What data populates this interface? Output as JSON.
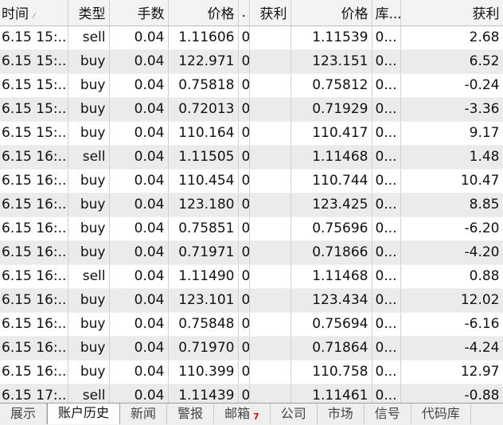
{
  "columns": [
    "时间",
    "类型",
    "手数",
    "价格",
    ".",
    "获利",
    "价格",
    "库...",
    "获利"
  ],
  "rows": [
    [
      "6.15 15:...",
      "sell",
      "0.04",
      "1.11606",
      "0.0...",
      "1.11539",
      "0...",
      "2.68"
    ],
    [
      "6.15 15:...",
      "buy",
      "0.04",
      "122.971",
      "0....",
      "123.151",
      "0...",
      "6.52"
    ],
    [
      "6.15 15:...",
      "buy",
      "0.04",
      "0.75818",
      "0.0...",
      "0.75812",
      "0...",
      "-0.24"
    ],
    [
      "6.15 15:...",
      "buy",
      "0.04",
      "0.72013",
      "0.0...",
      "0.71929",
      "0...",
      "-3.36"
    ],
    [
      "6.15 15:...",
      "buy",
      "0.04",
      "110.164",
      "0....",
      "110.417",
      "0...",
      "9.17"
    ],
    [
      "6.15 16:...",
      "sell",
      "0.04",
      "1.11505",
      "0.0...",
      "1.11468",
      "0...",
      "1.48"
    ],
    [
      "6.15 16:...",
      "buy",
      "0.04",
      "110.454",
      "0....",
      "110.744",
      "0...",
      "10.47"
    ],
    [
      "6.15 16:...",
      "buy",
      "0.04",
      "123.180",
      "0....",
      "123.425",
      "0...",
      "8.85"
    ],
    [
      "6.15 16:...",
      "buy",
      "0.04",
      "0.75851",
      "0.0...",
      "0.75696",
      "0...",
      "-6.20"
    ],
    [
      "6.15 16:...",
      "buy",
      "0.04",
      "0.71971",
      "0.0...",
      "0.71866",
      "0...",
      "-4.20"
    ],
    [
      "6.15 16:...",
      "sell",
      "0.04",
      "1.11490",
      "0.0...",
      "1.11468",
      "0...",
      "0.88"
    ],
    [
      "6.15 16:...",
      "buy",
      "0.04",
      "123.101",
      "0....",
      "123.434",
      "0...",
      "12.02"
    ],
    [
      "6.15 16:...",
      "buy",
      "0.04",
      "0.75848",
      "0.0...",
      "0.75694",
      "0...",
      "-6.16"
    ],
    [
      "6.15 16:...",
      "buy",
      "0.04",
      "0.71970",
      "0.0...",
      "0.71864",
      "0...",
      "-4.24"
    ],
    [
      "6.15 16:...",
      "buy",
      "0.04",
      "110.399",
      "0....",
      "110.758",
      "0...",
      "12.97"
    ],
    [
      "6.15 17:...",
      "sell",
      "0.04",
      "1.11439",
      "0.0...",
      "1.11461",
      "0...",
      "-0.88"
    ]
  ],
  "tabs": [
    {
      "label": "展示"
    },
    {
      "label": "账户历史",
      "active": true
    },
    {
      "label": "新闻"
    },
    {
      "label": "警报"
    },
    {
      "label": "邮箱",
      "badge": "7"
    },
    {
      "label": "公司"
    },
    {
      "label": "市场"
    },
    {
      "label": "信号"
    },
    {
      "label": "代码库"
    }
  ],
  "colors": {
    "row_alt": "#ebebeb",
    "header_bg": "#f3f3f3",
    "badge": "#d11111"
  }
}
